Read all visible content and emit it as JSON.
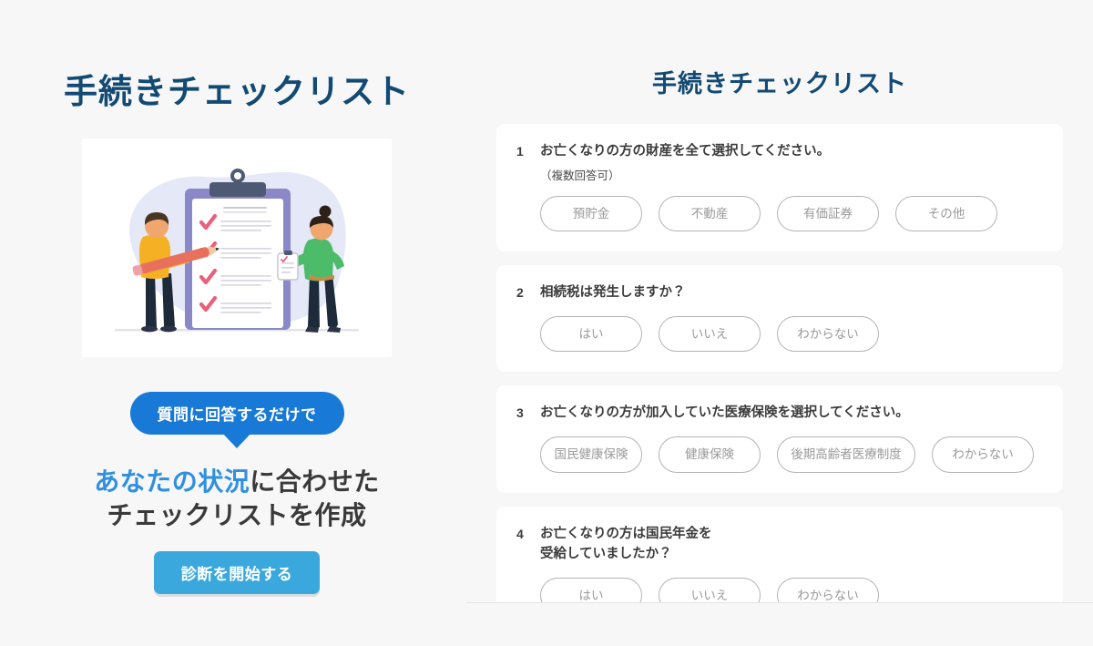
{
  "left": {
    "title": "手続きチェックリスト",
    "illustration_name": "checklist-people-illustration",
    "bubble_text": "質問に回答するだけで",
    "headline_accent": "あなたの状況",
    "headline_rest": "に合わせた",
    "headline_line2": "チェックリストを作成",
    "cta_label": "診断を開始する"
  },
  "right": {
    "title": "手続きチェックリスト",
    "questions": [
      {
        "number": "1",
        "text": "お亡くなりの方の財産を全て選択してください。",
        "sub": "（複数回答可）",
        "options": [
          "預貯金",
          "不動産",
          "有価証券",
          "その他"
        ]
      },
      {
        "number": "2",
        "text": "相続税は発生しますか？",
        "sub": "",
        "options": [
          "はい",
          "いいえ",
          "わからない"
        ]
      },
      {
        "number": "3",
        "text": "お亡くなりの方が加入していた医療保険を選択してください。",
        "sub": "",
        "options": [
          "国民健康保険",
          "健康保険",
          "後期高齢者医療制度",
          "わからない"
        ]
      },
      {
        "number": "4",
        "text": "お亡くなりの方は国民年金を\n受給していましたか？",
        "sub": "",
        "options": [
          "はい",
          "いいえ",
          "わからない"
        ]
      }
    ]
  },
  "colors": {
    "background": "#f7f7f7",
    "card": "#ffffff",
    "title_navy": "#134a73",
    "bubble_blue": "#1879d6",
    "cta_blue": "#3aa8dd",
    "accent_blue": "#2f8fe0",
    "pill_border": "#b3b3b3",
    "pill_text": "#9a9a9a",
    "question_text": "#3c3c3c"
  }
}
